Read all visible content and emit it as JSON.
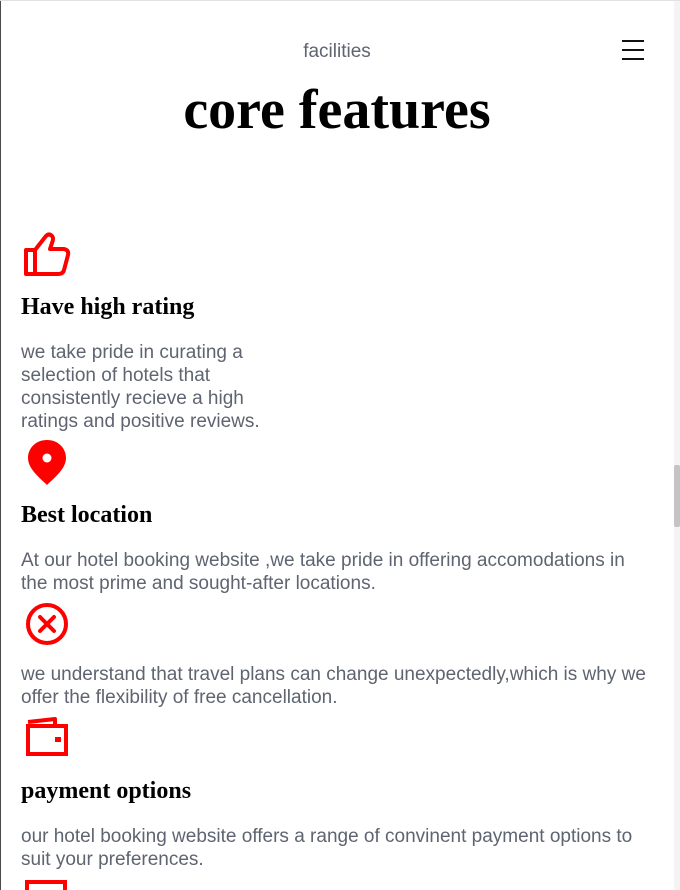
{
  "header": {
    "eyebrow": "facilities",
    "title": "core features"
  },
  "features": [
    {
      "icon": "thumbs-up-icon",
      "heading": "Have high rating",
      "text": "we take pride in curating a selection of hotels that consistently recieve a high ratings and positive reviews."
    },
    {
      "icon": "location-pin-icon",
      "heading": "Best location",
      "text": "At our hotel booking website ,we take pride in offering accomodations in the most prime and sought-after locations."
    },
    {
      "icon": "cancel-circle-icon",
      "heading": "",
      "text": "we understand that travel plans can change unexpectedly,which is why we offer the flexibility of free cancellation."
    },
    {
      "icon": "wallet-icon",
      "heading": "payment options",
      "text": "our hotel booking website offers a range of convinent payment options to suit your preferences."
    }
  ],
  "colors": {
    "accent": "#ff0000",
    "body_text": "#5e6470",
    "heading_text": "#000000"
  }
}
